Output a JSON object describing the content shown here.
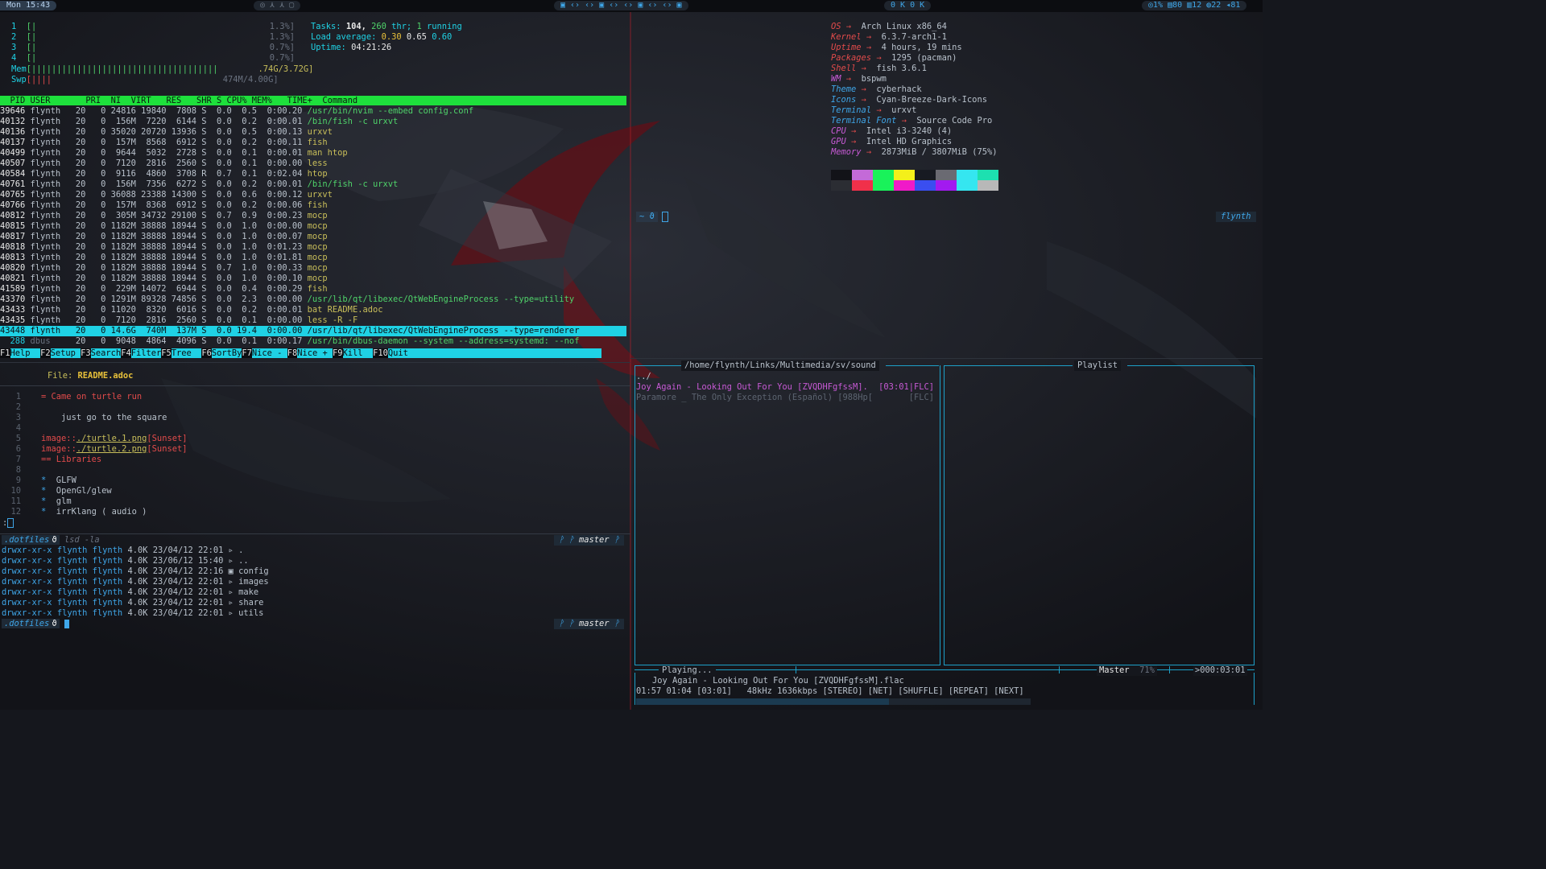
{
  "topbar": {
    "clock": "Mon 15:43",
    "workspaces": "◎ ⋏ ⋏ ▢",
    "tabs": "▣ ‹› ‹› ▣ ‹› ‹› ▣ ‹› ‹› ▣",
    "status_mid": "0 K 0 K",
    "status_right": "◎1% ▤80 ▥12 ◍22 ◂81"
  },
  "htop": {
    "cpus": [
      {
        "n": "1",
        "bar": "[|",
        "pct": "1.3%]"
      },
      {
        "n": "2",
        "bar": "[|",
        "pct": "1.3%]"
      },
      {
        "n": "3",
        "bar": "[|",
        "pct": "0.7%]"
      },
      {
        "n": "4",
        "bar": "[|",
        "pct": "0.7%]"
      }
    ],
    "mem_label": "Mem",
    "mem_bar": "[|||||||||||||||||||||||||||||||||||||",
    "mem_value": ".74G/3.72G]",
    "swp_label": "Swp",
    "swp_bar": "[||||",
    "swp_value": "474M/4.00G]",
    "tasks_label": "Tasks:",
    "tasks_count": "104,",
    "tasks_thr": "260",
    "tasks_thr_label": "thr;",
    "tasks_running": "1",
    "tasks_running_label": "running",
    "load_label": "Load average:",
    "load1": "0.30",
    "load5": "0.65",
    "load15": "0.60",
    "uptime_label": "Uptime:",
    "uptime": "04:21:26",
    "header": "  PID USER       PRI  NI  VIRT   RES   SHR S CPU% MEM%   TIME+  Command",
    "rows": [
      {
        "pid": "39646",
        "user": "flynth",
        "stats": "   20   0 24816 19840  7808 S  0.0  0.5  0:00.20",
        "cmd": "/usr/bin/nvim --embed config.conf"
      },
      {
        "pid": "40132",
        "user": "flynth",
        "stats": "   20   0  156M  7220  6144 S  0.0  0.2  0:00.01",
        "cmd": "/bin/fish -c urxvt"
      },
      {
        "pid": "40136",
        "user": "flynth",
        "stats": "   20   0 35020 20720 13936 S  0.0  0.5  0:00.13",
        "cmd": "urxvt"
      },
      {
        "pid": "40137",
        "user": "flynth",
        "stats": "   20   0  157M  8568  6912 S  0.0  0.2  0:00.11",
        "cmd": "fish"
      },
      {
        "pid": "40499",
        "user": "flynth",
        "stats": "   20   0  9644  5032  2728 S  0.0  0.1  0:00.01",
        "cmd": "man htop"
      },
      {
        "pid": "40507",
        "user": "flynth",
        "stats": "   20   0  7120  2816  2560 S  0.0  0.1  0:00.00",
        "cmd": "less"
      },
      {
        "pid": "40584",
        "user": "flynth",
        "stats": "   20   0  9116  4860  3708 R  0.7  0.1  0:02.04",
        "cmd": "htop"
      },
      {
        "pid": "40761",
        "user": "flynth",
        "stats": "   20   0  156M  7356  6272 S  0.0  0.2  0:00.01",
        "cmd": "/bin/fish -c urxvt"
      },
      {
        "pid": "40765",
        "user": "flynth",
        "stats": "   20   0 36088 23388 14300 S  0.0  0.6  0:00.12",
        "cmd": "urxvt"
      },
      {
        "pid": "40766",
        "user": "flynth",
        "stats": "   20   0  157M  8368  6912 S  0.0  0.2  0:00.06",
        "cmd": "fish"
      },
      {
        "pid": "40812",
        "user": "flynth",
        "stats": "   20   0  305M 34732 29100 S  0.7  0.9  0:00.23",
        "cmd": "mocp"
      },
      {
        "pid": "40815",
        "user": "flynth",
        "stats": "   20   0 1182M 38888 18944 S  0.0  1.0  0:00.00",
        "cmd": "mocp"
      },
      {
        "pid": "40817",
        "user": "flynth",
        "stats": "   20   0 1182M 38888 18944 S  0.0  1.0  0:00.07",
        "cmd": "mocp"
      },
      {
        "pid": "40818",
        "user": "flynth",
        "stats": "   20   0 1182M 38888 18944 S  0.0  1.0  0:01.23",
        "cmd": "mocp"
      },
      {
        "pid": "40813",
        "user": "flynth",
        "stats": "   20   0 1182M 38888 18944 S  0.0  1.0  0:01.81",
        "cmd": "mocp"
      },
      {
        "pid": "40820",
        "user": "flynth",
        "stats": "   20   0 1182M 38888 18944 S  0.7  1.0  0:00.33",
        "cmd": "mocp"
      },
      {
        "pid": "40821",
        "user": "flynth",
        "stats": "   20   0 1182M 38888 18944 S  0.0  1.0  0:00.10",
        "cmd": "mocp"
      },
      {
        "pid": "41589",
        "user": "flynth",
        "stats": "   20   0  229M 14072  6944 S  0.0  0.4  0:00.29",
        "cmd": "fish"
      },
      {
        "pid": "43370",
        "user": "flynth",
        "stats": "   20   0 1291M 89328 74856 S  0.0  2.3  0:00.00",
        "cmd": "/usr/lib/qt/libexec/QtWebEngineProcess --type=utility"
      },
      {
        "pid": "43433",
        "user": "flynth",
        "stats": "   20   0 11020  8320  6016 S  0.0  0.2  0:00.01",
        "cmd": "bat README.adoc"
      },
      {
        "pid": "43435",
        "user": "flynth",
        "stats": "   20   0  7120  2816  2560 S  0.0  0.1  0:00.00",
        "cmd": "less -R -F"
      },
      {
        "pid": "43448",
        "user": "flynth",
        "stats": "   20   0 14.6G  740M  137M S  0.0 19.4  0:00.00",
        "cmd": "/usr/lib/qt/libexec/QtWebEngineProcess --type=renderer"
      },
      {
        "pid": "  288",
        "user": "dbus  ",
        "stats": "   20   0  9048  4864  4096 S  0.0  0.1  0:00.17",
        "cmd": "/usr/bin/dbus-daemon --system --address=systemd: --nof"
      }
    ],
    "fkeys": [
      {
        "k": "F1",
        "l": "Help  "
      },
      {
        "k": "F2",
        "l": "Setup "
      },
      {
        "k": "F3",
        "l": "Search"
      },
      {
        "k": "F4",
        "l": "Filter"
      },
      {
        "k": "F5",
        "l": "Tree  "
      },
      {
        "k": "F6",
        "l": "SortBy"
      },
      {
        "k": "F7",
        "l": "Nice - "
      },
      {
        "k": "F8",
        "l": "Nice + "
      },
      {
        "k": "F9",
        "l": "Kill  "
      },
      {
        "k": "F10",
        "l": "Quit"
      }
    ]
  },
  "fetch": {
    "items": [
      {
        "key": "OS",
        "value": "Arch Linux x86_64"
      },
      {
        "key": "Kernel",
        "value": "6.3.7-arch1-1"
      },
      {
        "key": "Uptime",
        "value": "4 hours, 19 mins"
      },
      {
        "key": "Packages",
        "value": "1295 (pacman)"
      },
      {
        "key": "Shell",
        "value": "fish 3.6.1"
      },
      {
        "key": "WM",
        "value": "bspwm"
      },
      {
        "key": "Theme",
        "value": "cyberhack"
      },
      {
        "key": "Icons",
        "value": "Cyan-Breeze-Dark-Icons"
      },
      {
        "key": "Terminal",
        "value": "urxvt"
      },
      {
        "key": "Terminal Font",
        "value": "Source Code Pro"
      },
      {
        "key": "CPU",
        "value": "Intel i3-3240 (4)"
      },
      {
        "key": "GPU",
        "value": "Intel HD Graphics"
      },
      {
        "key": "Memory",
        "value": "2873MiB / 3807MiB (75%)"
      }
    ],
    "arrow": "→",
    "key_colors": [
      "#e34b4b",
      "#e34b4b",
      "#e34b4b",
      "#e34b4b",
      "#e34b4b",
      "#c85ad6",
      "#3fa6e8",
      "#3fa6e8",
      "#3fa6e8",
      "#3fa6e8",
      "#c85ad6",
      "#c85ad6",
      "#c85ad6"
    ],
    "palette_top": [
      "#121318",
      "#c46ad8",
      "#19f25a",
      "#f4f01a",
      "#171a22",
      "#6a6a72",
      "#35e6f0",
      "#1de0b0"
    ],
    "palette_bottom": [
      "#2b2d33",
      "#f0304a",
      "#19f25a",
      "#f01ac8",
      "#3a4ef0",
      "#a21af0",
      "#35e6f0",
      "#b8b8b8"
    ],
    "prompt": "~ ϑ",
    "user_tag": "flynth"
  },
  "bat": {
    "file_label": "File:",
    "file_name": "README.adoc",
    "lines": [
      {
        "n": "1",
        "text": "= Came on turtle run",
        "cls": "red"
      },
      {
        "n": "2",
        "text": "",
        "cls": ""
      },
      {
        "n": "3",
        "text": "    just go to the square",
        "cls": "white"
      },
      {
        "n": "4",
        "text": "",
        "cls": ""
      },
      {
        "n": "5",
        "pre": "image::",
        "link": "./turtle.1.png",
        "post": "[Sunset]"
      },
      {
        "n": "6",
        "pre": "image::",
        "link": "./turtle.2.png",
        "post": "[Sunset]"
      },
      {
        "n": "7",
        "text": "== Libraries",
        "cls": "red"
      },
      {
        "n": "8",
        "text": "",
        "cls": ""
      },
      {
        "n": "9",
        "bullet": "*",
        "text": "  GLFW"
      },
      {
        "n": "10",
        "bullet": "*",
        "text": "  OpenGl/glew"
      },
      {
        "n": "11",
        "bullet": "*",
        "text": "  glm"
      },
      {
        "n": "12",
        "bullet": "*",
        "text": "  irrKlang ( audio )"
      }
    ],
    "pager_prompt": ":"
  },
  "shell": {
    "prompt_dir": ".dotfiles",
    "prompt_sym": "ϑ",
    "command": "lsd -la",
    "git_branch": "master",
    "git_icons": "ᚹ ᚹ",
    "git_end": "ᚹ",
    "entries": [
      {
        "perm": "drwxr-xr-x",
        "u": "flynth",
        "g": "flynth",
        "size": "4.0K",
        "date": "23/04/12 22:01",
        "icon": "▹",
        "name": "."
      },
      {
        "perm": "drwxr-xr-x",
        "u": "flynth",
        "g": "flynth",
        "size": "4.0K",
        "date": "23/06/12 15:40",
        "icon": "▹",
        "name": ".."
      },
      {
        "perm": "drwxr-xr-x",
        "u": "flynth",
        "g": "flynth",
        "size": "4.0K",
        "date": "23/04/12 22:16",
        "icon": "▣",
        "name": "config"
      },
      {
        "perm": "drwxr-xr-x",
        "u": "flynth",
        "g": "flynth",
        "size": "4.0K",
        "date": "23/04/12 22:01",
        "icon": "▹",
        "name": "images"
      },
      {
        "perm": "drwxr-xr-x",
        "u": "flynth",
        "g": "flynth",
        "size": "4.0K",
        "date": "23/04/12 22:01",
        "icon": "▹",
        "name": "make"
      },
      {
        "perm": "drwxr-xr-x",
        "u": "flynth",
        "g": "flynth",
        "size": "4.0K",
        "date": "23/04/12 22:01",
        "icon": "▹",
        "name": "share"
      },
      {
        "perm": "drwxr-xr-x",
        "u": "flynth",
        "g": "flynth",
        "size": "4.0K",
        "date": "23/04/12 22:01",
        "icon": "▹",
        "name": "utils"
      }
    ]
  },
  "moc": {
    "dir_title": "/home/flynth/Links/Multimedia/sv/sound",
    "playlist_title": "Playlist",
    "files": [
      {
        "name": "../",
        "info": ""
      },
      {
        "name": "Joy Again - Looking Out For You [ZVQDHFgfssM].",
        "info": "[03:01|FLC]",
        "playing": true
      },
      {
        "name": "Paramore _ The Only Exception (Español) [988Hp[",
        "info": "     [FLC]"
      }
    ],
    "state": "Playing...",
    "mixer": "Master",
    "volume": "71%",
    "timer": ">000:03:01",
    "now_playing": "Joy Again - Looking Out For You [ZVQDHFgfssM].flac",
    "time_line": "01:57 01:04 [03:01]   48kHz 1636kbps [STEREO] [NET] [SHUFFLE] [REPEAT] [NEXT]",
    "progress_fraction": 0.64
  }
}
